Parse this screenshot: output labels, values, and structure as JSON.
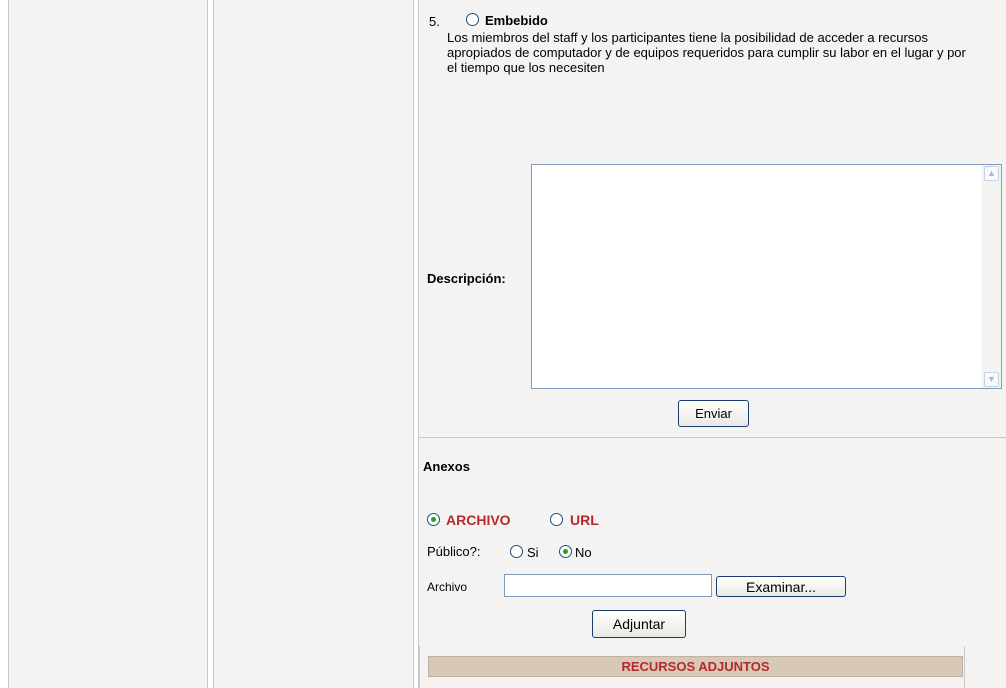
{
  "question": {
    "number": "5.",
    "option_label": "Embebido",
    "description": "Los miembros del staff y los participantes tiene la posibilidad de acceder a recursos apropiados de computador y de equipos requeridos para cumplir su labor en el lugar y por el tiempo que los necesiten"
  },
  "form": {
    "description_label": "Descripción:",
    "description_value": "",
    "submit_label": "Enviar"
  },
  "attachments": {
    "heading": "Anexos",
    "type_options": [
      "ARCHIVO",
      "URL"
    ],
    "selected_type": "ARCHIVO",
    "public_label": "Público?:",
    "public_options": [
      "Si",
      "No"
    ],
    "selected_public": "No",
    "file_label": "Archivo",
    "file_value": "",
    "browse_label": "Examinar...",
    "attach_label": "Adjuntar",
    "resources_header": "RECURSOS ADJUNTOS"
  },
  "colors": {
    "panel_bg": "#f4f3f2",
    "accent_red": "#b52a2a",
    "resources_bg": "#d8c8b8",
    "radio_selected": "#21a121"
  }
}
